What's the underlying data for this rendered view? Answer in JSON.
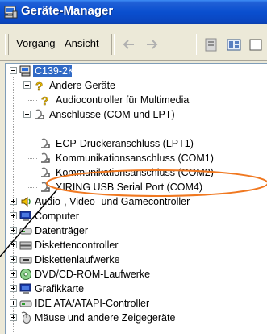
{
  "window": {
    "title": "Geräte-Manager"
  },
  "menu": {
    "items": [
      {
        "label_underlined": "V",
        "label_rest": "organg"
      },
      {
        "label_underlined": "A",
        "label_rest": "nsicht"
      }
    ]
  },
  "toolbar": {
    "back_icon": "back-arrow-icon",
    "forward_icon": "forward-arrow-icon",
    "properties_icon": "properties-icon",
    "view_icon": "view-icon"
  },
  "tree": {
    "root": "C139-2K",
    "nodes": [
      {
        "label": "Andere Geräte",
        "icon": "unknown-device-icon",
        "expanded": true
      },
      {
        "label": "Audiocontroller für Multimedia",
        "icon": "unknown-device-icon"
      },
      {
        "label": "Anschlüsse (COM und LPT)",
        "icon": "port-icon",
        "expanded": true
      },
      {
        "label": "ECP-Druckeranschluss (LPT1)",
        "icon": "port-icon"
      },
      {
        "label": "Kommunikationsanschluss (COM1)",
        "icon": "port-icon"
      },
      {
        "label": "Kommunikationsanschluss (COM2)",
        "icon": "port-icon"
      },
      {
        "label": "XIRING USB Serial Port (COM4)",
        "icon": "port-icon"
      },
      {
        "label": "Audio-, Video- und Gamecontroller",
        "icon": "sound-icon",
        "expanded": false
      },
      {
        "label": "Computer",
        "icon": "computer-icon",
        "expanded": false
      },
      {
        "label": "Datenträger",
        "icon": "disk-icon",
        "expanded": false
      },
      {
        "label": "Diskettencontroller",
        "icon": "floppy-controller-icon",
        "expanded": false
      },
      {
        "label": "Diskettenlaufwerke",
        "icon": "floppy-drive-icon",
        "expanded": false
      },
      {
        "label": "DVD/CD-ROM-Laufwerke",
        "icon": "cdrom-icon",
        "expanded": false
      },
      {
        "label": "Grafikkarte",
        "icon": "display-icon",
        "expanded": false
      },
      {
        "label": "IDE ATA/ATAPI-Controller",
        "icon": "ide-controller-icon",
        "expanded": false
      },
      {
        "label": "Mäuse und andere Zeigegeräte",
        "icon": "mouse-icon",
        "expanded": false
      }
    ]
  },
  "colors": {
    "selection": "#316ac5",
    "annotation": "#f07820",
    "titlebar": "#0a4fcf"
  }
}
